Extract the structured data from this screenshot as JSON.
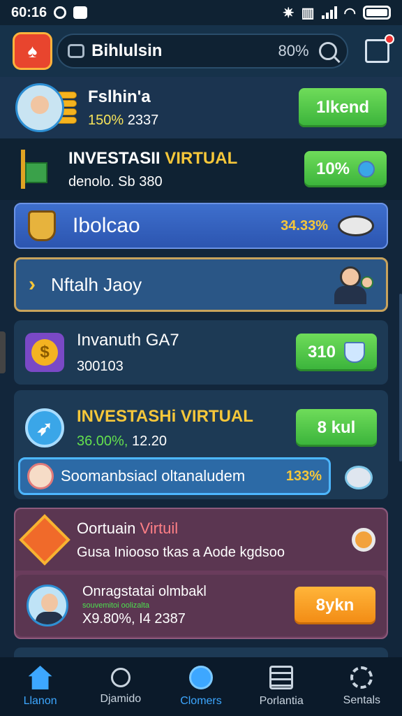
{
  "status_bar": {
    "time": "60:16",
    "icons": [
      "whatsapp-icon",
      "bag-icon",
      "nfc-icon",
      "vibrate-icon",
      "signal-icon",
      "wifi-icon",
      "battery-icon"
    ]
  },
  "header": {
    "title": "Bihlulsin",
    "percent": "80%"
  },
  "row1": {
    "name": "Fslhin'a",
    "stat_green": "150%",
    "stat_value": "2337",
    "button": "1lkend"
  },
  "row2": {
    "name_plain": "INVESTASII ",
    "name_gold": "VIRTUAL",
    "sub": "denolo. Sb 380",
    "button": "10%"
  },
  "banner1": {
    "label": "Ibolcao",
    "percent": "34.33%"
  },
  "banner2": {
    "label": "Nftalh Jaoy"
  },
  "card1": {
    "name": "Invanuth GA7",
    "sub": "300103",
    "button": "310"
  },
  "card2": {
    "name": "INVESTASHi VIRTUAL",
    "stat_green": "36.00%,",
    "stat_value": "12.20",
    "button": "8 kul",
    "pill_label": "Soomanbsiacl oltanaludem",
    "pill_percent": "133%"
  },
  "card3": {
    "item1": {
      "name_plain": "Oortuain ",
      "name_red": "Virtuil",
      "sub": "Gusa Iniooso tkas a Aode kgdsoo"
    },
    "item2": {
      "name": "Onragstatai olmbakl",
      "sub_small": "souvemitoi oolizalta",
      "sub": "X9.80%, I4 2387",
      "button": "8ykn"
    }
  },
  "bottom_nav": [
    {
      "label": "Llanon",
      "icon": "home-icon",
      "active": false
    },
    {
      "label": "Djamido",
      "icon": "search-icon",
      "active": false
    },
    {
      "label": "Clomers",
      "icon": "planet-icon",
      "active": true
    },
    {
      "label": "Porlantia",
      "icon": "document-icon",
      "active": false
    },
    {
      "label": "Sentals",
      "icon": "settings-icon",
      "active": false
    }
  ],
  "colors": {
    "background": "#12263b",
    "accent_green": "#39b23a",
    "accent_gold": "#f6c73a",
    "accent_blue": "#3da7ff",
    "accent_orange": "#f28a13"
  }
}
